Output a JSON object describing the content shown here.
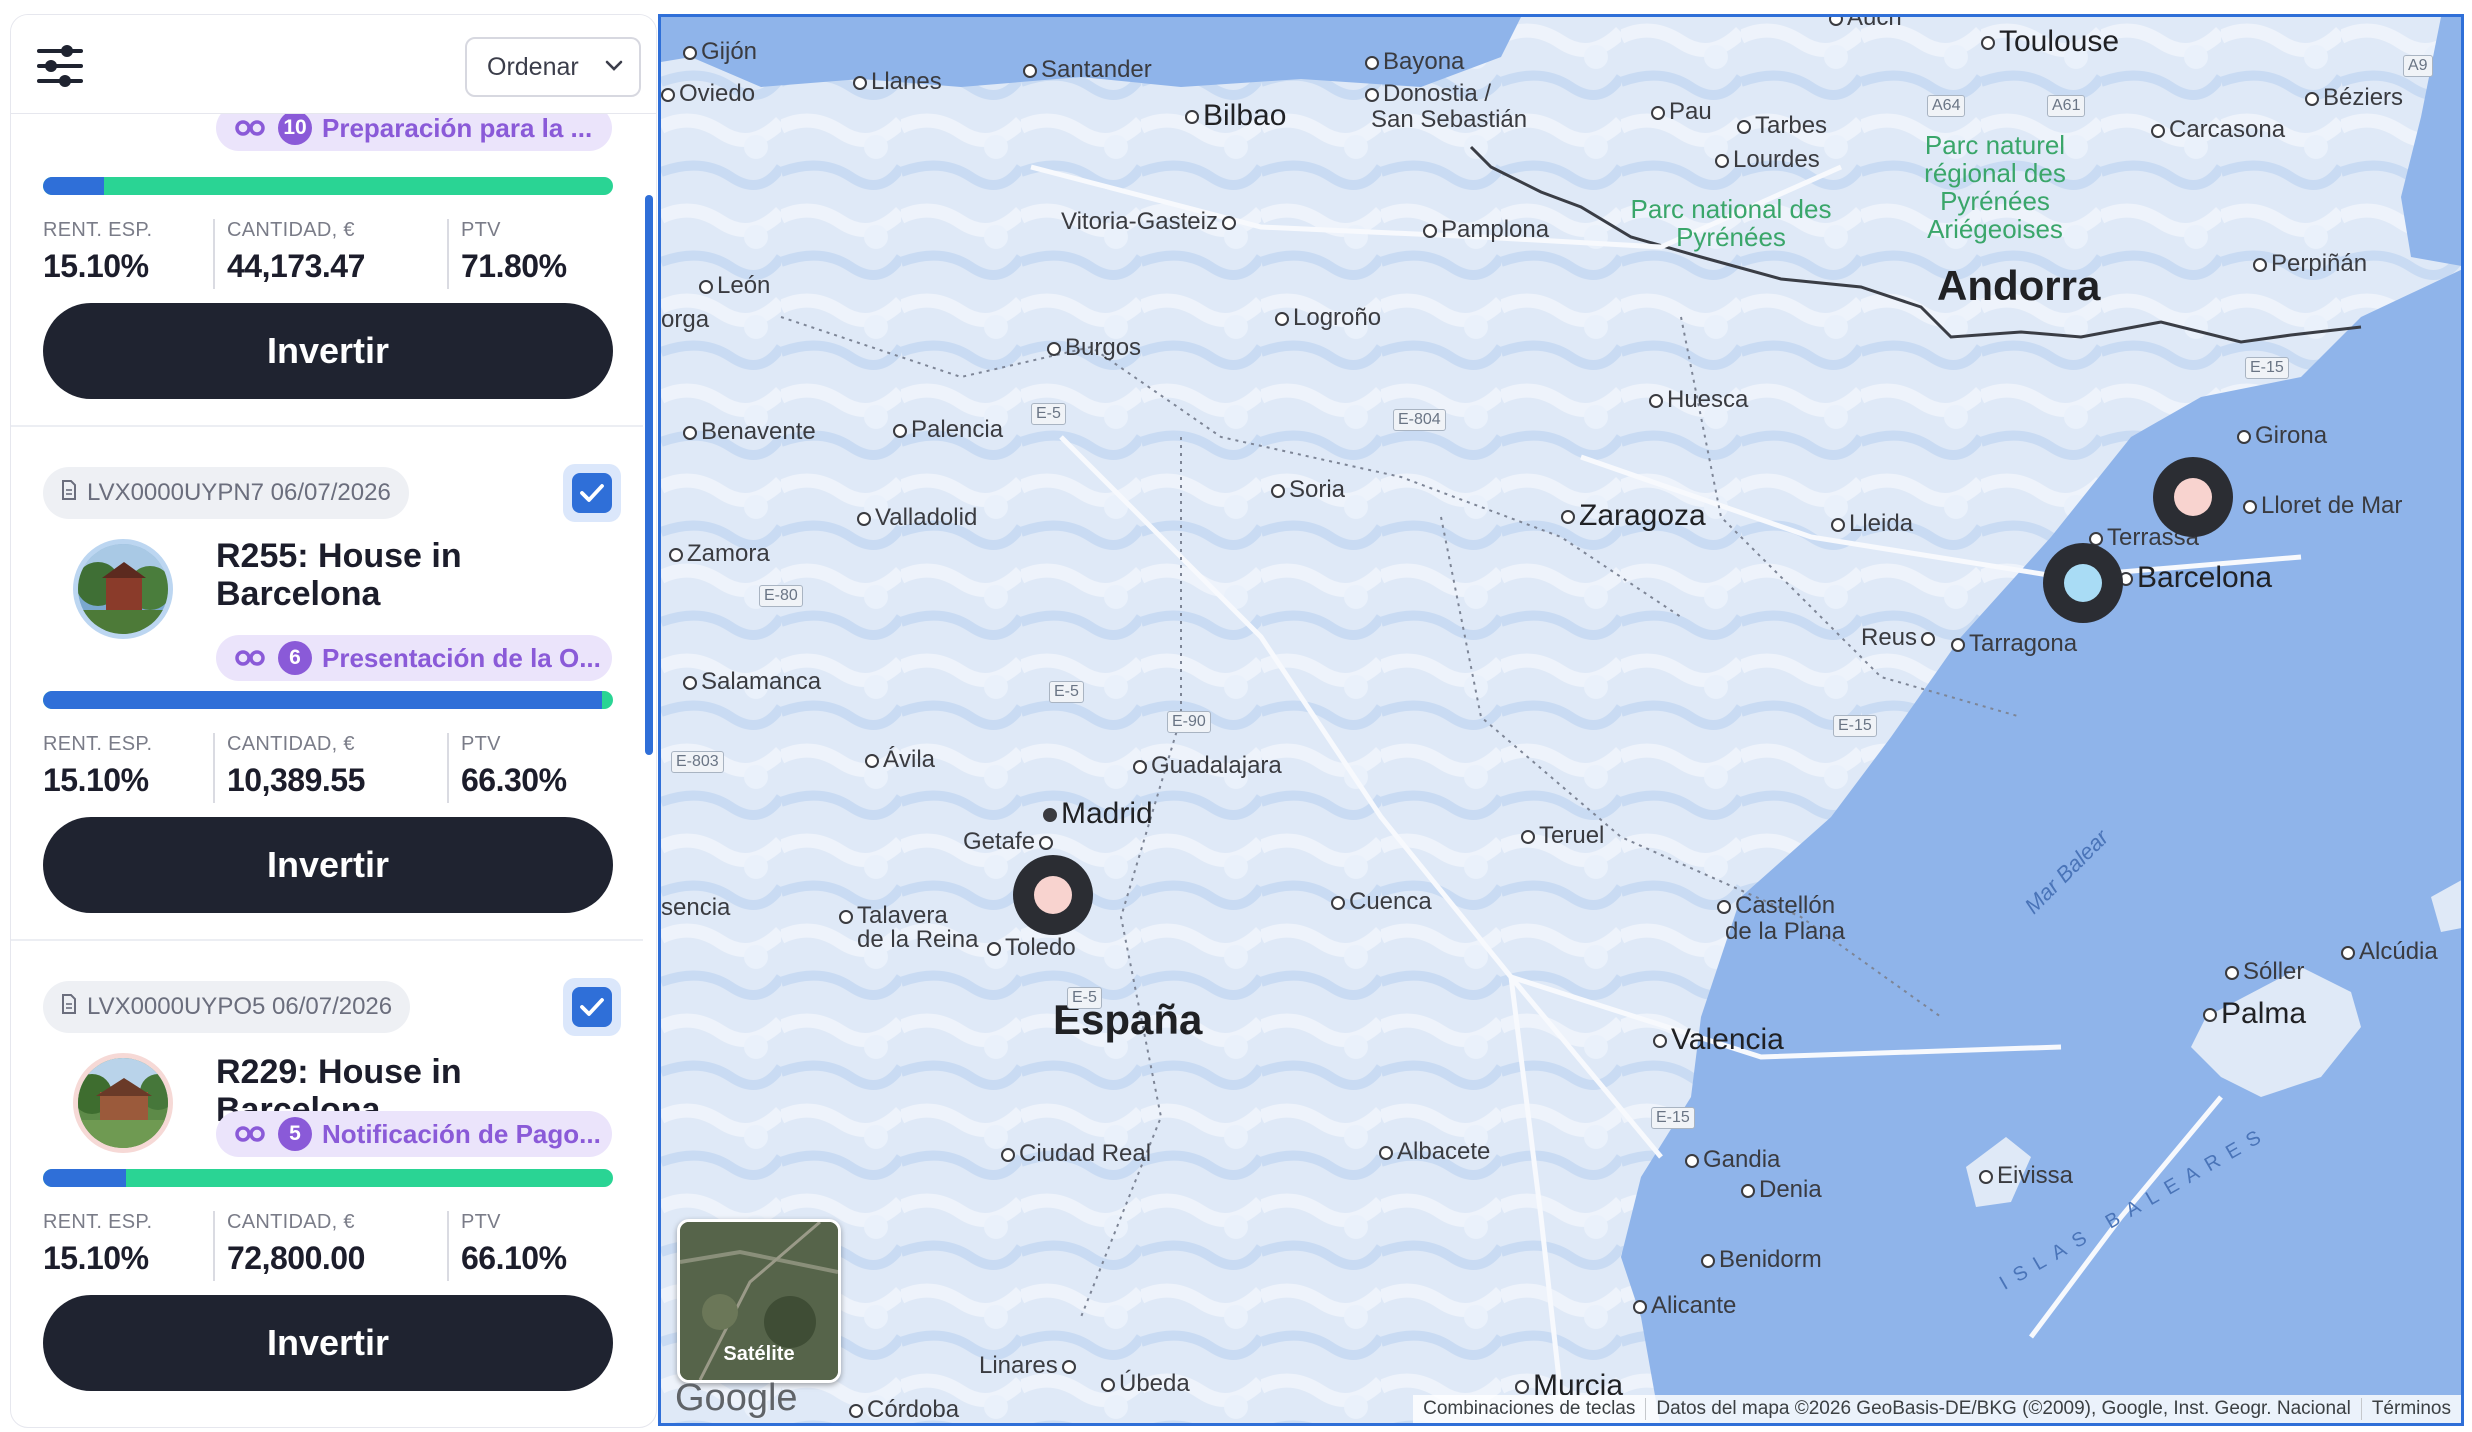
{
  "toolbar": {
    "sort_label": "Ordenar"
  },
  "cards": [
    {
      "stage_number": "10",
      "stage_label": "Preparación para la ...",
      "progress": 0.107,
      "stats": [
        {
          "label": "RENT. ESP.",
          "value": "15.10%"
        },
        {
          "label": "CANTIDAD, €",
          "value": "44,173.47"
        },
        {
          "label": "PTV",
          "value": "71.80%"
        }
      ],
      "button": "Invertir"
    },
    {
      "id": "LVX0000UYPN7 06/07/2026",
      "checked": true,
      "title": "R255: House in Barcelona",
      "stage_number": "6",
      "stage_label": "Presentación de la O...",
      "progress": 0.98,
      "stats": [
        {
          "label": "RENT. ESP.",
          "value": "15.10%"
        },
        {
          "label": "CANTIDAD, €",
          "value": "10,389.55"
        },
        {
          "label": "PTV",
          "value": "66.30%"
        }
      ],
      "button": "Invertir"
    },
    {
      "id": "LVX0000UYPO5 06/07/2026",
      "checked": true,
      "title": "R229: House in Barcelona",
      "stage_number": "5",
      "stage_label": "Notificación de Pago...",
      "progress": 0.146,
      "stats": [
        {
          "label": "RENT. ESP.",
          "value": "15.10%"
        },
        {
          "label": "CANTIDAD, €",
          "value": "72,800.00"
        },
        {
          "label": "PTV",
          "value": "66.10%"
        }
      ],
      "button": "Invertir"
    }
  ],
  "map": {
    "cities": {
      "gijon": "Gijón",
      "oviedo": "Oviedo",
      "llanes": "Llanes",
      "santander": "Santander",
      "bilbao": "Bilbao",
      "bayona": "Bayona",
      "donostia": "Donostia /",
      "sansebastian": "San Sebastián",
      "pau": "Pau",
      "tarbes": "Tarbes",
      "lourdes": "Lourdes",
      "auch": "Auch",
      "toulouse": "Toulouse",
      "carcasona": "Carcasona",
      "beziers": "Béziers",
      "vitoria": "Vitoria-Gasteiz",
      "pamplona": "Pamplona",
      "perpinan": "Perpiñán",
      "leon": "León",
      "astorga": "orga",
      "logrono": "Logroño",
      "burgos": "Burgos",
      "andorra": "Andorra",
      "huesca": "Huesca",
      "girona": "Girona",
      "benavente": "Benavente",
      "palencia": "Palencia",
      "soria": "Soria",
      "lloret": "Lloret de Mar",
      "valladolid": "Valladolid",
      "zaragoza": "Zaragoza",
      "lleida": "Lleida",
      "terrassa": "Terrassa",
      "zamora": "Zamora",
      "barcelona": "Barcelona",
      "reus": "Reus",
      "tarragona": "Tarragona",
      "salamanca": "Salamanca",
      "avila": "Ávila",
      "guadalajara": "Guadalajara",
      "madrid": "Madrid",
      "getafe": "Getafe",
      "teruel": "Teruel",
      "plasencia": "sencia",
      "talavera": "Talavera",
      "delareina": "de la Reina",
      "toledo": "Toledo",
      "cuenca": "Cuenca",
      "castellon": "Castellón",
      "delaplana": "de la Plana",
      "soller": "Sóller",
      "alcudia": "Alcúdia",
      "palma": "Palma",
      "espana": "España",
      "valencia": "Valencia",
      "ciudadreal": "Ciudad Real",
      "albacete": "Albacete",
      "gandia": "Gandia",
      "denia": "Denia",
      "eivissa": "Eivissa",
      "benidorm": "Benidorm",
      "alicante": "Alicante",
      "linares": "Linares",
      "ubeda": "Úbeda",
      "murcia": "Murcia",
      "cordoba": "Córdoba"
    },
    "parks": {
      "pyrenees": "Parc national des Pyrénées",
      "ariegeoises": "Parc naturel régional des Pyrénées Ariégeoises"
    },
    "seas": {
      "balear": "Mar Balear",
      "islas": "ISLAS BALEARES"
    },
    "roads": [
      "A64",
      "A61",
      "A9",
      "E-5",
      "E-804",
      "E-15",
      "E-80",
      "E-90",
      "E-803",
      "E-5",
      "E-15",
      "E-5",
      "E-15"
    ],
    "satellite_label": "Satélite",
    "logo": "Google",
    "attribution": {
      "shortcuts": "Combinaciones de teclas",
      "data": "Datos del mapa ©2026 GeoBasis-DE/BKG (©2009), Google, Inst. Geogr. Nacional",
      "terms": "Términos"
    },
    "marker_colors": {
      "pink": "#f8d3cf",
      "blue": "#a9dcf5"
    }
  },
  "colors": {
    "accent": "#2f6fd8",
    "progress_green": "#2ad494",
    "stage_purple": "#8a5ad8",
    "dark_button": "#1f2330"
  }
}
